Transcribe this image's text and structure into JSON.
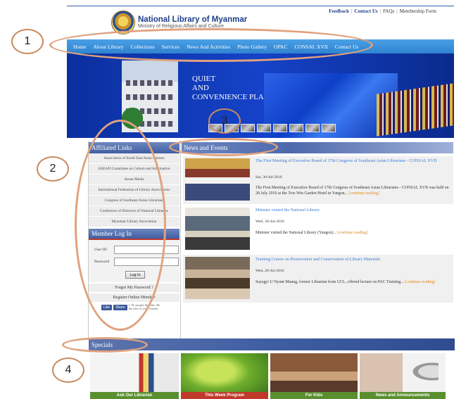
{
  "header": {
    "site_title": "National Library of Myanmar",
    "site_subtitle": "Ministry of Religious Affairs and Culture",
    "top_links": [
      "Feedback",
      "Contact Us",
      "FAQs",
      "Membership Form"
    ]
  },
  "nav": {
    "items": [
      "Home",
      "About Library",
      "Collections",
      "Services",
      "News And Activities",
      "Photo Gallery",
      "OPAC",
      "CONSAL XVII",
      "Contact Us"
    ]
  },
  "banner": {
    "line1": "QUIET",
    "line2": "AND",
    "line3": "CONVENIENCE PLACE"
  },
  "sidebar": {
    "affiliated_title": "Affiliated Links",
    "affiliated_links": [
      "Association of South East Asian Nations",
      "ASEAN Committee on Culture and Information",
      "Asean Media",
      "International Federation of Library Associations",
      "Congress of Southeast Asian Librarians",
      "Conference of Directors of National Libraries",
      "Myanmar Library Association"
    ],
    "login_title": "Member Log In",
    "user_id_label": "User ID",
    "password_label": "Password",
    "login_button": "Log In",
    "forgot_password": "Forgot My Password ?",
    "register": "Register Online Member",
    "fb_like": "Like",
    "fb_share": "Share",
    "fb_text": "1.1K people like this. Be the first of your friends."
  },
  "news": {
    "title": "News and Events",
    "items": [
      {
        "title": "The First Meeting of Executive Board of 17th Congress of Southeast Asian Librarians - CONSAL XVII",
        "date": "Sat, 30-Jul-2016",
        "desc": "The First Meeting of Executive Board of 17th Congress of Southeast Asian Librarians - CONSAL XVII was held on 28 July 2016 at the Tow Win Garden Hotel in Yangon...",
        "more": "[continue reading]"
      },
      {
        "title": "Minister visited the National Library",
        "date": "Wed, 20-Jul-2016",
        "desc": "Minister visited the National Library (Yangon)...",
        "more": "[continue reading]"
      },
      {
        "title": "Training Course on Preservation and Conservation of Library Materials",
        "date": "Wed, 20-Jul-2016",
        "desc": "Sayagyi U Nyunt Maung, former Librarian from UCL, offered lecture on PAC Training...",
        "more": "[continue reading]"
      }
    ]
  },
  "specials": {
    "title": "Specials",
    "items": [
      {
        "label": "Ask Our Librarian",
        "color": "#5a8f2f"
      },
      {
        "label": "This Week Program",
        "color": "#c0392b"
      },
      {
        "label": "For Kids",
        "color": "#5a8f2f"
      },
      {
        "label": "News and Announcements",
        "color": "#5a8f2f"
      }
    ]
  },
  "annotations": [
    "1",
    "2",
    "3",
    "4"
  ]
}
